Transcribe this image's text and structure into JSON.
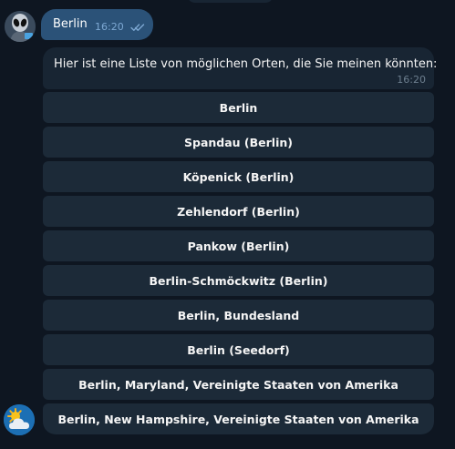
{
  "chat": {
    "outgoing": {
      "text": "Berlin",
      "time": "16:20"
    },
    "incoming": {
      "text": "Hier ist eine Liste von möglichen Orten, die Sie meinen könnten:",
      "time": "16:20"
    },
    "buttons": [
      "Berlin",
      "Spandau (Berlin)",
      "Köpenick (Berlin)",
      "Zehlendorf (Berlin)",
      "Pankow (Berlin)",
      "Berlin-Schmöckwitz (Berlin)",
      "Berlin, Bundesland",
      "Berlin (Seedorf)",
      "Berlin, Maryland, Vereinigte Staaten von Amerika",
      "Berlin, New Hampshire, Vereinigte Staaten von Amerika"
    ]
  },
  "colors": {
    "background": "#0e1621",
    "outgoing_bubble": "#2b5278",
    "incoming_bubble": "#182533",
    "keyboard_button": "#1c2a38"
  },
  "icons": {
    "user_avatar": "alien-avatar-icon",
    "bot_avatar": "sun-cloud-weather-icon",
    "read_status": "double-check-icon"
  }
}
